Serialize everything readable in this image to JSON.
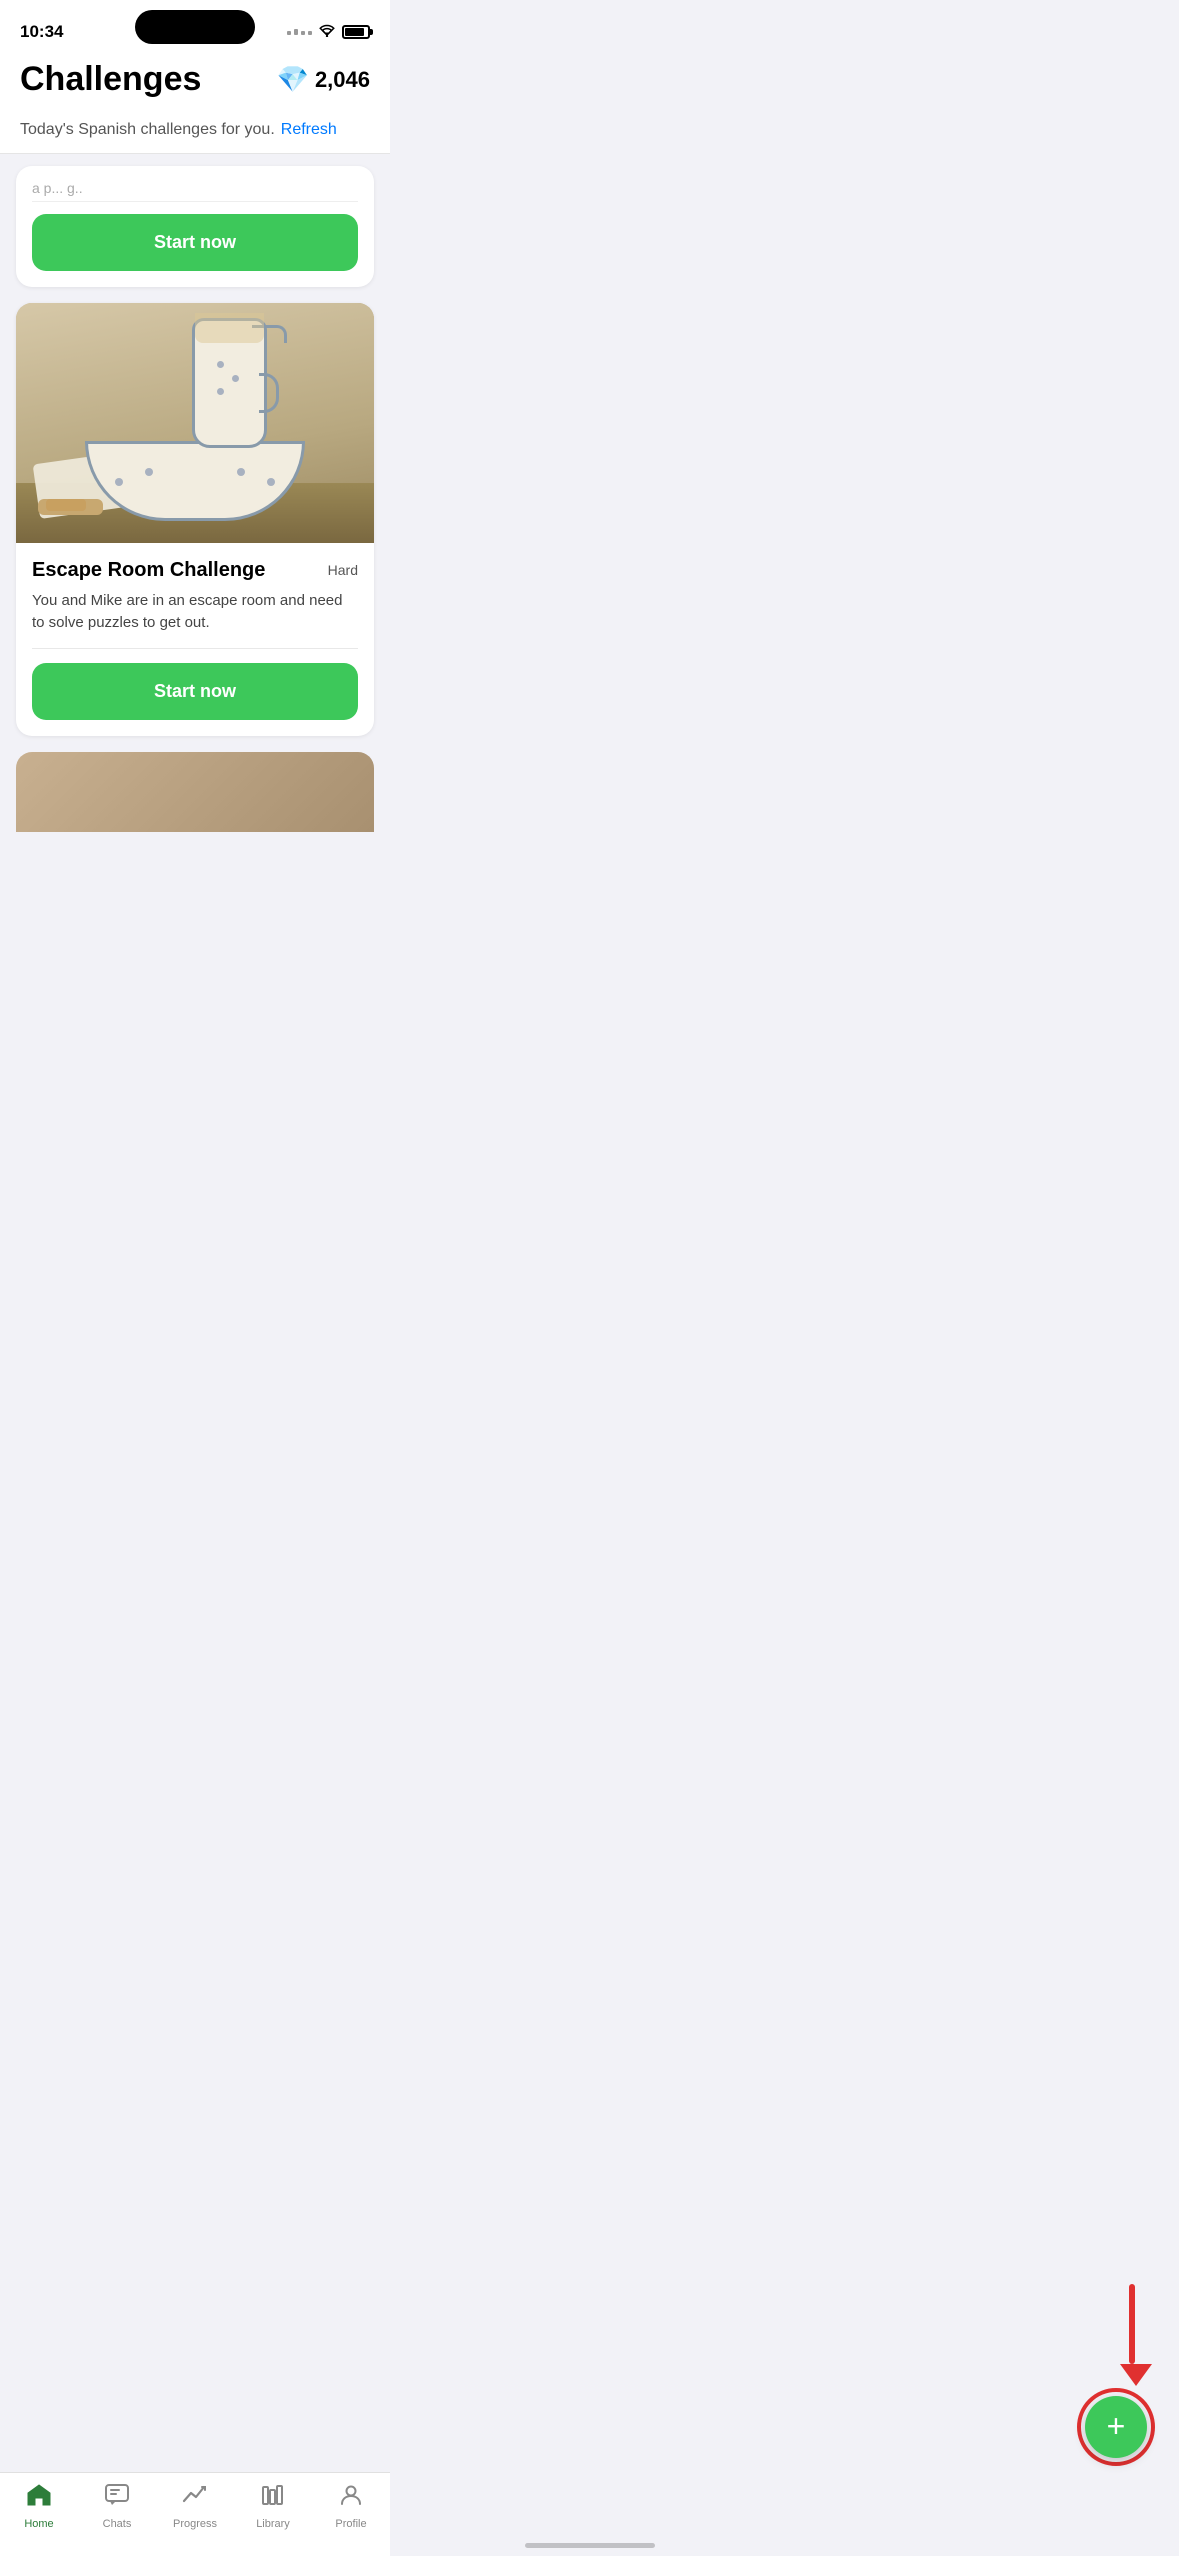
{
  "status": {
    "time": "10:34"
  },
  "gems": {
    "icon": "💎",
    "count": "2,046"
  },
  "header": {
    "title": "Challenges",
    "subtitle": "Today's Spanish challenges for you.",
    "refresh_label": "Refresh"
  },
  "cards": [
    {
      "id": "card1",
      "partial": true,
      "start_label": "Start now"
    },
    {
      "id": "card2",
      "title": "Escape Room Challenge",
      "difficulty": "Hard",
      "description": "You and Mike are in an escape room and need to solve puzzles to get out.",
      "start_label": "Start now"
    }
  ],
  "fab": {
    "label": "+"
  },
  "bottom_nav": {
    "items": [
      {
        "id": "home",
        "label": "Home",
        "icon": "⌂",
        "active": true
      },
      {
        "id": "chats",
        "label": "Chats",
        "icon": "◫",
        "active": false
      },
      {
        "id": "progress",
        "label": "Progress",
        "icon": "📈",
        "active": false
      },
      {
        "id": "library",
        "label": "Library",
        "icon": "📚",
        "active": false
      },
      {
        "id": "profile",
        "label": "Profile",
        "icon": "👤",
        "active": false
      }
    ]
  }
}
